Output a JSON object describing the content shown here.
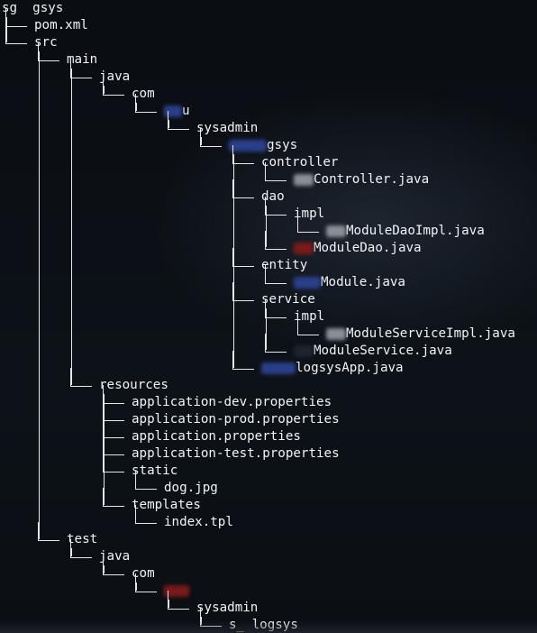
{
  "tree": {
    "root": "sg  gsys",
    "files_root": [
      "pom.xml"
    ],
    "src": "src",
    "main": "main",
    "java": "java",
    "com": "com",
    "pkg_company": "u",
    "sysadmin": "sysadmin",
    "pkg_logsys": "gsys",
    "controller": "controller",
    "controller_file": "Controller.java",
    "dao": "dao",
    "dao_impl": "impl",
    "dao_impl_file": "ModuleDaoImpl.java",
    "dao_file": "ModuleDao.java",
    "entity": "entity",
    "entity_file": "Module.java",
    "service": "service",
    "service_impl": "impl",
    "service_impl_file": "ModuleServiceImpl.java",
    "service_file": "ModuleService.java",
    "app_file": "logsysApp.java",
    "resources": "resources",
    "res_files": [
      "application-dev.properties",
      "application-prod.properties",
      "application.properties",
      "application-test.properties"
    ],
    "static": "static",
    "static_file": "dog.jpg",
    "templates": "templates",
    "templates_file": "index.tpl",
    "test": "test",
    "test_java": "java",
    "test_com": "com",
    "test_sysadmin": "sysadmin",
    "test_logsys": "logsys"
  },
  "colors": {
    "background": "#0b0f14",
    "text": "#f2f4f6",
    "blur_blue": "#2a3f8a",
    "blur_red": "#7a1a1a",
    "blur_gray": "#8a8f96"
  }
}
